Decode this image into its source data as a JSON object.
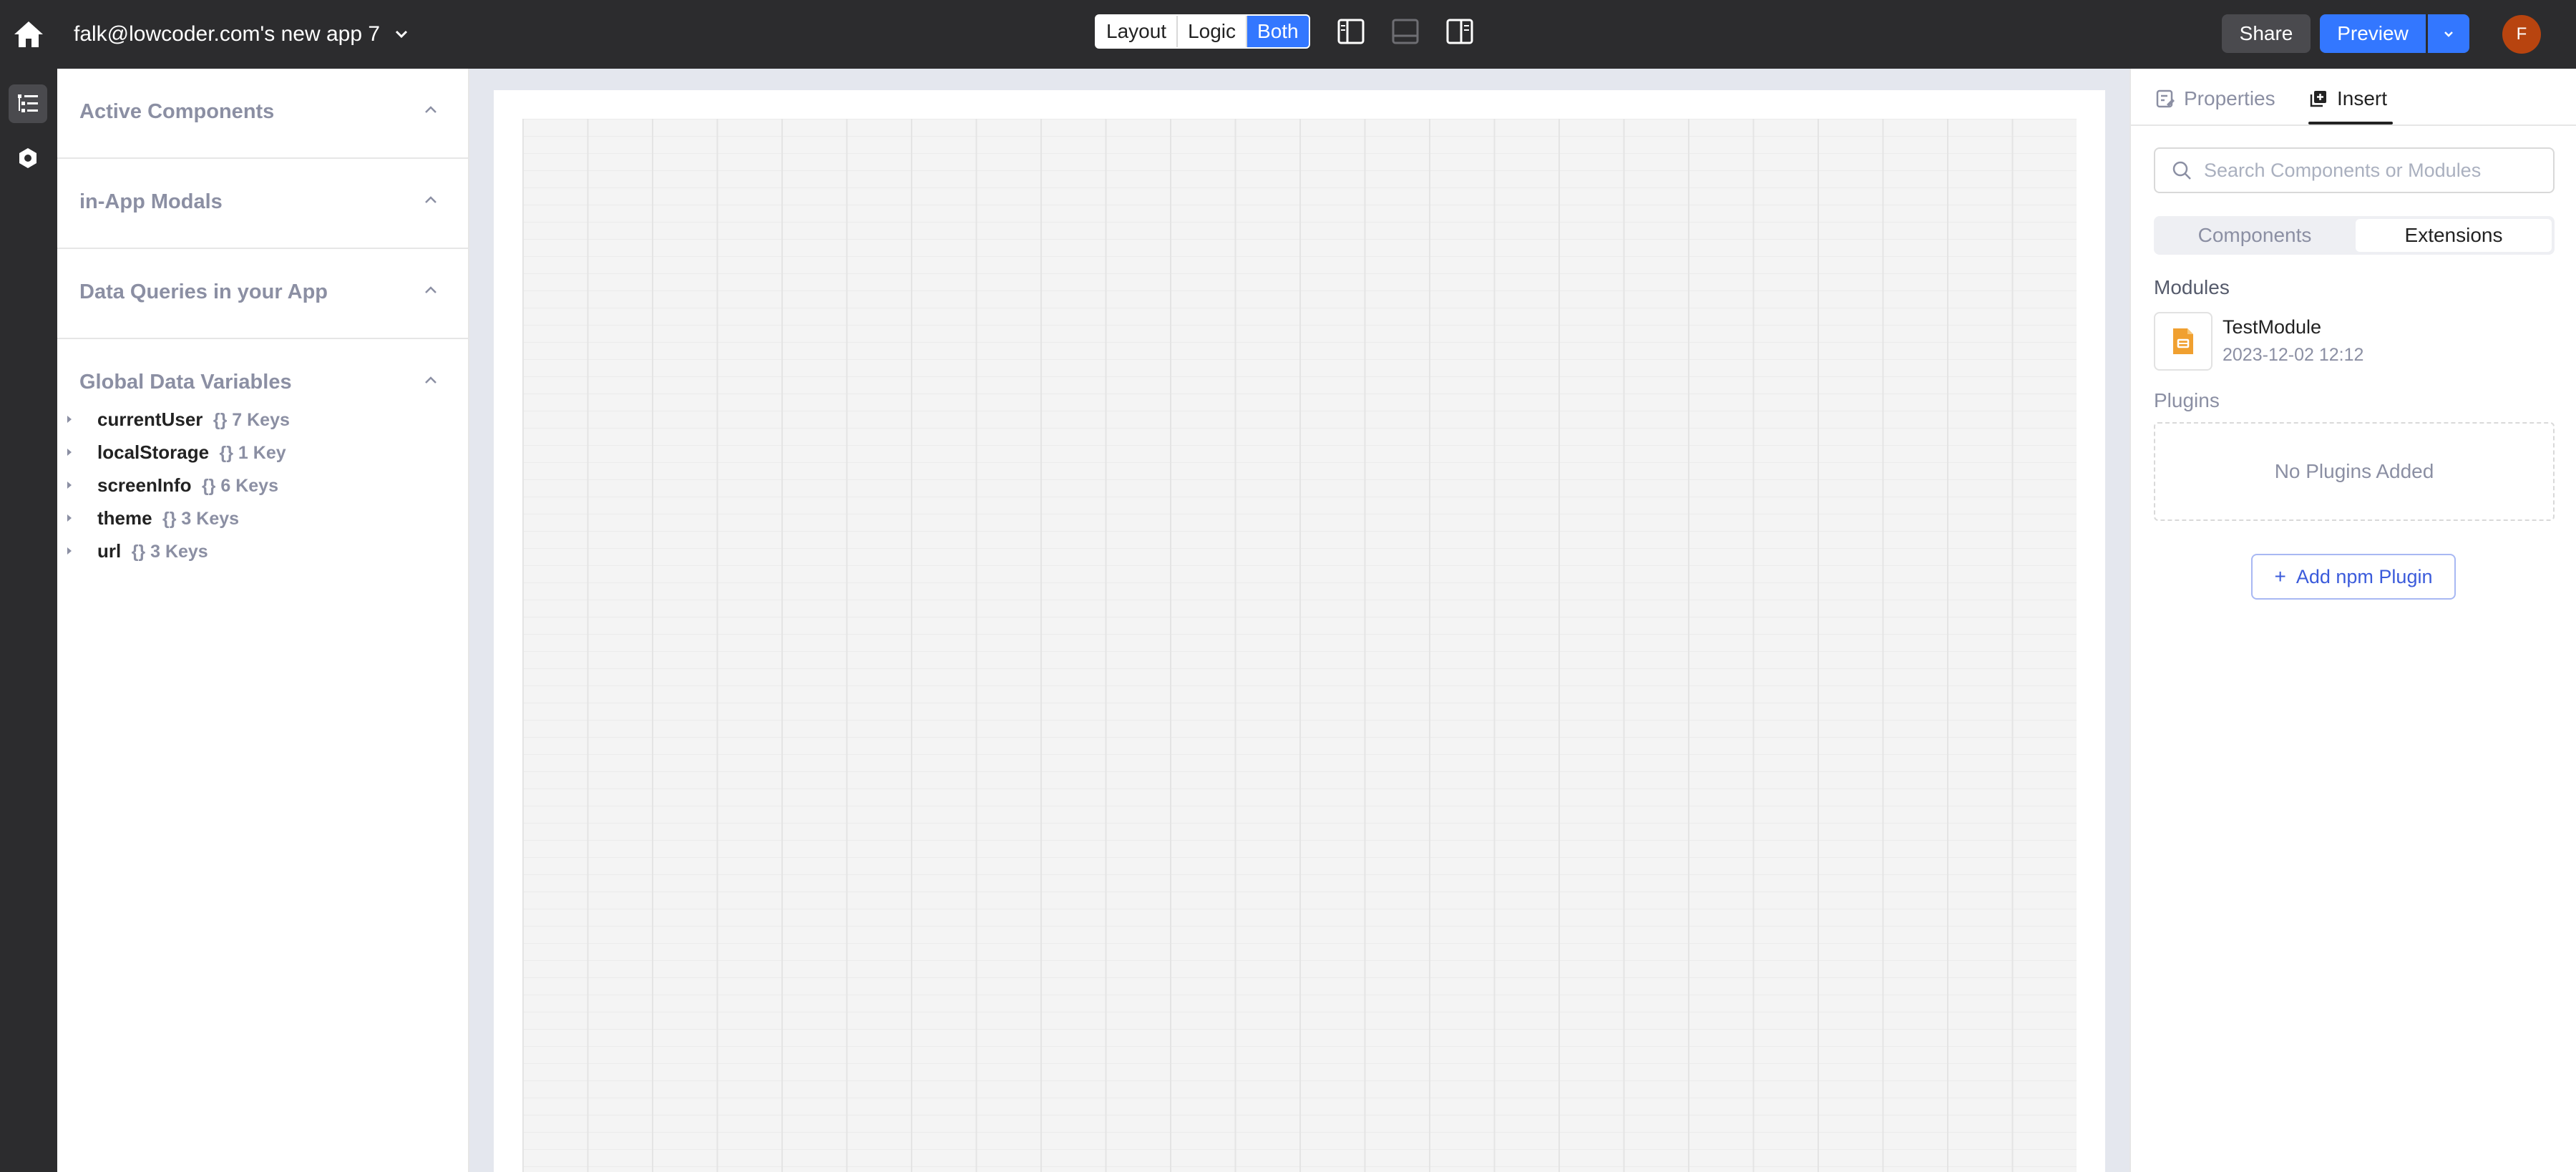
{
  "header": {
    "app_title": "falk@lowcoder.com's new app 7",
    "modes": [
      "Layout",
      "Logic",
      "Both"
    ],
    "active_mode": "Both",
    "share_label": "Share",
    "preview_label": "Preview",
    "avatar_initial": "F"
  },
  "left_panel": {
    "sections": [
      {
        "title": "Active Components"
      },
      {
        "title": "in-App Modals"
      },
      {
        "title": "Data Queries in your App"
      },
      {
        "title": "Global Data Variables"
      }
    ],
    "variables": [
      {
        "name": "currentUser",
        "meta": "{} 7 Keys"
      },
      {
        "name": "localStorage",
        "meta": "{} 1 Key"
      },
      {
        "name": "screenInfo",
        "meta": "{} 6 Keys"
      },
      {
        "name": "theme",
        "meta": "{} 3 Keys"
      },
      {
        "name": "url",
        "meta": "{} 3 Keys"
      }
    ]
  },
  "right_panel": {
    "tabs": [
      {
        "label": "Properties",
        "icon": "properties-icon"
      },
      {
        "label": "Insert",
        "icon": "insert-icon"
      }
    ],
    "active_tab": "Insert",
    "search_placeholder": "Search Components or Modules",
    "switch_options": [
      "Components",
      "Extensions"
    ],
    "active_switch": "Extensions",
    "modules_label": "Modules",
    "module": {
      "name": "TestModule",
      "date": "2023-12-02 12:12"
    },
    "plugins_label": "Plugins",
    "no_plugins_text": "No Plugins Added",
    "add_plugin_label": "Add npm Plugin"
  },
  "colors": {
    "header_bg": "#2c2c2e",
    "accent": "#3377ff",
    "avatar": "#b8440f",
    "muted_text": "#8b8fa3",
    "module_icon": "#f0a030"
  }
}
